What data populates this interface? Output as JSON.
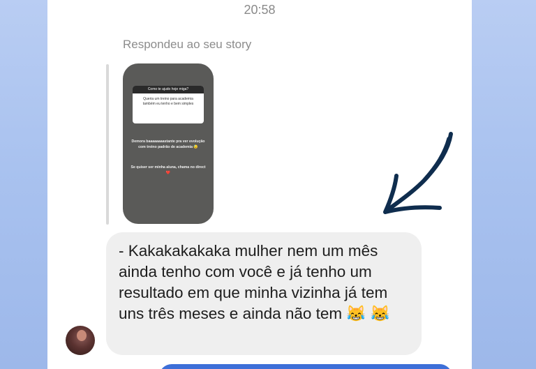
{
  "chat": {
    "timestamp": "20:58",
    "reply_label": "Respondeu ao seu story",
    "message": "- Kakakakakaka mulher nem um mês ainda tenho com você e já tenho um resultado em que minha vizinha já tem uns três meses e ainda não tem 😹 😹"
  },
  "story": {
    "question": "Como te ajudo hoje miga?",
    "answer": "Queria um treino para academia também eu tenho e bem simples",
    "caption": "Demora baaaaaaaastante pra ver evolução com treino padrão de academia 😓",
    "cta": "Se quiser ser minha aluna, chama no direct ❤️"
  },
  "icons": {
    "arrow": "hand-drawn-arrow-icon",
    "avatar": "user-avatar"
  },
  "colors": {
    "arrow": "#0f2d4e",
    "bubble": "#efefef",
    "background": "#a9c2ef"
  }
}
